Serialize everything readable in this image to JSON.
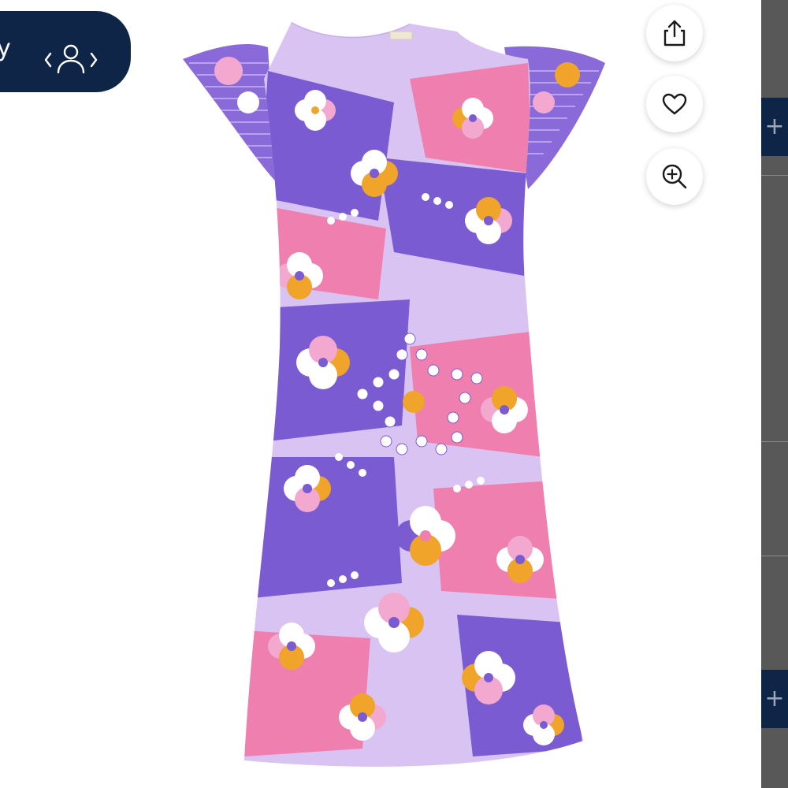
{
  "nav": {
    "pill_text": "y",
    "icon": "person-switch-icon"
  },
  "actions": {
    "share_icon": "share-icon",
    "favorite_icon": "heart-icon",
    "zoom_icon": "zoom-in-icon"
  },
  "side_panel": {
    "expand_top_label": "+",
    "expand_bottom_label": "+"
  },
  "product": {
    "image_kind": "dress-photo"
  },
  "colors": {
    "navy": "#0f2547",
    "violet": "#7a5bd1",
    "lavender": "#d7bff0",
    "pink": "#ef7fae",
    "orange": "#f0a42a"
  }
}
